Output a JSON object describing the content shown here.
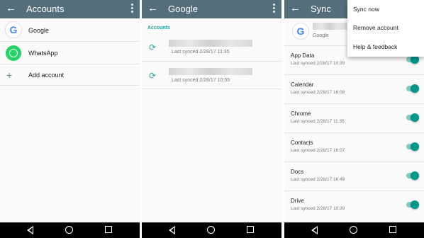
{
  "panel1": {
    "title": "Accounts",
    "accounts": [
      {
        "label": "Google",
        "icon": "google-icon"
      },
      {
        "label": "WhatsApp",
        "icon": "whatsapp-icon"
      }
    ],
    "add_account": "Add account"
  },
  "panel2": {
    "title": "Google",
    "section": "Accounts",
    "entries": [
      {
        "synced": "Last synced 2/28/17 11:35"
      },
      {
        "synced": "Last synced 2/28/17 10:55"
      }
    ]
  },
  "panel3": {
    "title": "Sync",
    "account_type": "Google",
    "rows": [
      {
        "label": "App Data",
        "synced": "Last synced 2/28/17 10:39",
        "on": true
      },
      {
        "label": "Calendar",
        "synced": "Last synced 2/28/17 16:08",
        "on": true
      },
      {
        "label": "Chrome",
        "synced": "Last synced 2/28/17 11:35",
        "on": true
      },
      {
        "label": "Contacts",
        "synced": "Last synced 2/28/17 16:07",
        "on": true
      },
      {
        "label": "Docs",
        "synced": "Last synced 2/28/17 16:49",
        "on": true
      },
      {
        "label": "Drive",
        "synced": "Last synced 2/28/17 10:39",
        "on": true
      }
    ],
    "menu": [
      "Sync now",
      "Remove account",
      "Help & feedback"
    ]
  },
  "colors": {
    "toolbar": "#546e7a",
    "accent": "#26a69a",
    "toggle": "#009688"
  }
}
